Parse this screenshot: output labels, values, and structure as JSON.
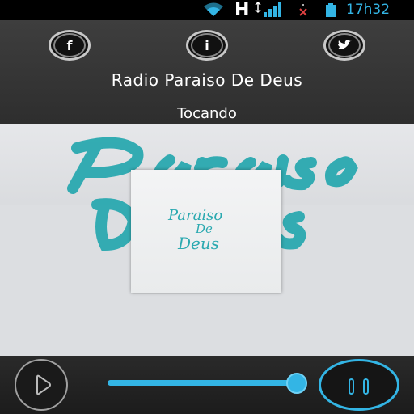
{
  "status_bar": {
    "network_type": "H",
    "time": "17h32",
    "icons": [
      "wifi-icon",
      "signal-icon",
      "no-sim-icon",
      "battery-icon"
    ],
    "accent": "#33b5e5"
  },
  "header": {
    "station_name": "Radio Paraiso De Deus",
    "status": "Tocando",
    "social": [
      {
        "name": "facebook",
        "glyph": "f"
      },
      {
        "name": "info",
        "glyph": "i"
      },
      {
        "name": "twitter",
        "glyph": "twitter-bird"
      }
    ]
  },
  "artwork": {
    "logo_text_line1": "Paraiso",
    "logo_text_line2": "De",
    "logo_text_line3": "Deus",
    "logo_color": "#2aa9b0"
  },
  "player": {
    "volume": 0.92,
    "accent": "#33b5e5"
  }
}
